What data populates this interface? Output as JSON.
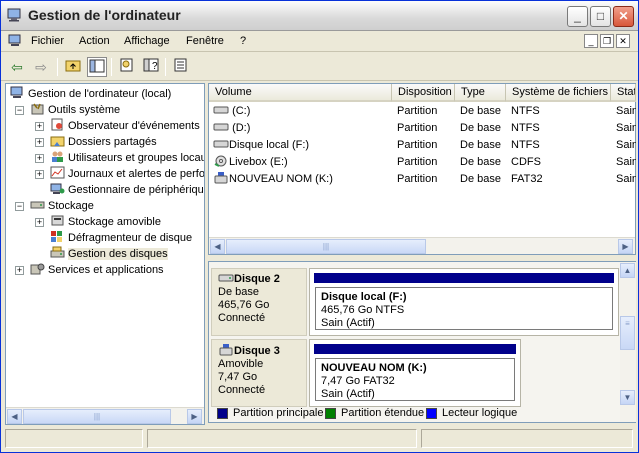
{
  "window": {
    "title": "Gestion de l'ordinateur"
  },
  "menu": {
    "items": [
      "Fichier",
      "Action",
      "Affichage",
      "Fenêtre",
      "?"
    ]
  },
  "tree": {
    "root": "Gestion de l'ordinateur (local)",
    "items": [
      {
        "label": "Outils système",
        "icon": "tools-icon"
      },
      {
        "label": "Observateur d'événements",
        "icon": "event-viewer-icon"
      },
      {
        "label": "Dossiers partagés",
        "icon": "shared-folder-icon"
      },
      {
        "label": "Utilisateurs et groupes locaux",
        "icon": "users-icon"
      },
      {
        "label": "Journaux et alertes de performance",
        "icon": "perf-log-icon"
      },
      {
        "label": "Gestionnaire de périphériques",
        "icon": "device-manager-icon"
      },
      {
        "label": "Stockage",
        "icon": "storage-icon"
      },
      {
        "label": "Stockage amovible",
        "icon": "removable-storage-icon"
      },
      {
        "label": "Défragmenteur de disque",
        "icon": "defrag-icon"
      },
      {
        "label": "Gestion des disques",
        "icon": "disk-management-icon"
      },
      {
        "label": "Services et applications",
        "icon": "services-icon"
      }
    ]
  },
  "volumes": {
    "headers": [
      "Volume",
      "Disposition",
      "Type",
      "Système de fichiers",
      "Statut"
    ],
    "rows": [
      {
        "volume": "(C:)",
        "disposition": "Partition",
        "type": "De base",
        "fs": "NTFS",
        "status": "Sain"
      },
      {
        "volume": "(D:)",
        "disposition": "Partition",
        "type": "De base",
        "fs": "NTFS",
        "status": "Sain"
      },
      {
        "volume": "Disque local (F:)",
        "disposition": "Partition",
        "type": "De base",
        "fs": "NTFS",
        "status": "Sain"
      },
      {
        "volume": "Livebox (E:)",
        "disposition": "Partition",
        "type": "De base",
        "fs": "CDFS",
        "status": "Sain"
      },
      {
        "volume": "NOUVEAU NOM (K:)",
        "disposition": "Partition",
        "type": "De base",
        "fs": "FAT32",
        "status": "Sain"
      }
    ]
  },
  "disks": [
    {
      "name": "Disque 2",
      "type": "De base",
      "size": "465,76 Go",
      "state": "Connecté",
      "partition": {
        "name": "Disque local  (F:)",
        "detail": "465,76 Go NTFS",
        "health": "Sain (Actif)"
      }
    },
    {
      "name": "Disque 3",
      "type": "Amovible",
      "size": "7,47 Go",
      "state": "Connecté",
      "partition": {
        "name": "NOUVEAU NOM  (K:)",
        "detail": "7,47 Go FAT32",
        "health": "Sain (Actif)"
      }
    }
  ],
  "legend": [
    {
      "label": "Partition principale",
      "color": "#00008b"
    },
    {
      "label": "Partition étendue",
      "color": "#008000"
    },
    {
      "label": "Lecteur logique",
      "color": "#0000ff"
    }
  ]
}
